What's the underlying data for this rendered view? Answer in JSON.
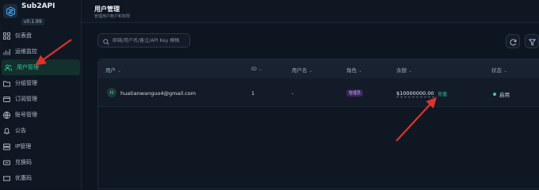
{
  "app": {
    "name": "Sub2API",
    "version": "v0.1.99"
  },
  "sidebar": {
    "items": [
      {
        "label": "仪表盘",
        "icon": "dashboard-icon"
      },
      {
        "label": "运维监控",
        "icon": "chart-icon"
      },
      {
        "label": "用户管理",
        "icon": "users-icon",
        "active": true
      },
      {
        "label": "分组管理",
        "icon": "folder-icon"
      },
      {
        "label": "订阅管理",
        "icon": "card-icon"
      },
      {
        "label": "账号管理",
        "icon": "globe-icon"
      },
      {
        "label": "公告",
        "icon": "bell-icon"
      },
      {
        "label": "IP管理",
        "icon": "server-icon"
      },
      {
        "label": "兑换码",
        "icon": "ticket-icon"
      },
      {
        "label": "优惠码",
        "icon": "ticket-icon"
      }
    ]
  },
  "header": {
    "title": "用户管理",
    "subtitle": "管理用户账户和权限"
  },
  "search": {
    "placeholder": "邮箱/用户名/备注/API Key 模糊"
  },
  "table": {
    "columns": [
      "用户",
      "ID",
      "用户名",
      "角色",
      "余额",
      "状态"
    ],
    "rows": [
      {
        "avatar": "H",
        "email": "huatianwanguo4@gmail.com",
        "id": "1",
        "username": "-",
        "role": "管理员",
        "balance": "$10000000.00",
        "action": "充值",
        "status": "启用"
      }
    ]
  },
  "colors": {
    "accent": "#34c7a4",
    "annotation": "#e0322a",
    "background": "#0d1520"
  }
}
